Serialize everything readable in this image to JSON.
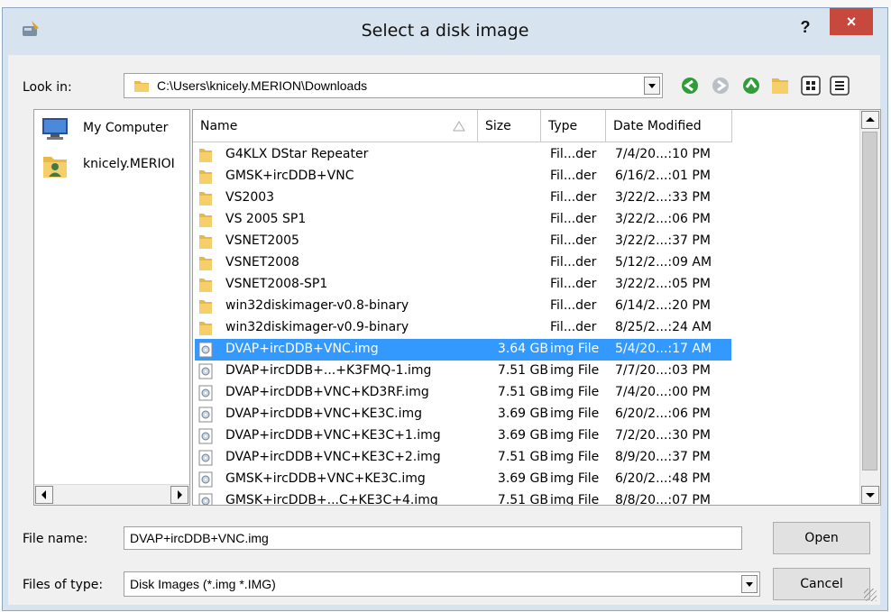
{
  "dialog": {
    "title": "Select a disk image",
    "help_label": "?",
    "close_label": "×"
  },
  "look_in": {
    "label": "Look in:",
    "path": "C:\\Users\\knicely.MERION\\Downloads",
    "toolbar_icons": [
      "back-icon",
      "forward-icon",
      "up-folder-icon",
      "new-folder-icon",
      "list-view-icon",
      "details-view-icon"
    ]
  },
  "places": [
    {
      "label": "My Computer",
      "icon": "computer-icon"
    },
    {
      "label": "knicely.MERIOI",
      "icon": "user-folder-icon"
    }
  ],
  "columns": {
    "name": "Name",
    "size": "Size",
    "type": "Type",
    "date": "Date Modified"
  },
  "files": [
    {
      "name": "G4KLX DStar Repeater",
      "size": "",
      "type": "Fil...der",
      "date": "7/4/20...:10 PM",
      "kind": "folder"
    },
    {
      "name": "GMSK+ircDDB+VNC",
      "size": "",
      "type": "Fil...der",
      "date": "6/16/2...:01 PM",
      "kind": "folder"
    },
    {
      "name": "VS2003",
      "size": "",
      "type": "Fil...der",
      "date": "3/22/2...:33 PM",
      "kind": "folder"
    },
    {
      "name": "VS 2005 SP1",
      "size": "",
      "type": "Fil...der",
      "date": "3/22/2...:06 PM",
      "kind": "folder"
    },
    {
      "name": "VSNET2005",
      "size": "",
      "type": "Fil...der",
      "date": "3/22/2...:37 PM",
      "kind": "folder"
    },
    {
      "name": "VSNET2008",
      "size": "",
      "type": "Fil...der",
      "date": "5/12/2...:09 AM",
      "kind": "folder"
    },
    {
      "name": "VSNET2008-SP1",
      "size": "",
      "type": "Fil...der",
      "date": "3/22/2...:05 PM",
      "kind": "folder"
    },
    {
      "name": "win32diskimager-v0.8-binary",
      "size": "",
      "type": "Fil...der",
      "date": "6/14/2...:20 PM",
      "kind": "folder"
    },
    {
      "name": "win32diskimager-v0.9-binary",
      "size": "",
      "type": "Fil...der",
      "date": "8/25/2...:24 AM",
      "kind": "folder"
    },
    {
      "name": "DVAP+ircDDB+VNC.img",
      "size": "3.64 GB",
      "type": "img File",
      "date": "5/4/20...:17 AM",
      "kind": "img"
    },
    {
      "name": "DVAP+ircDDB+...+K3FMQ-1.img",
      "size": "7.51 GB",
      "type": "img File",
      "date": "7/7/20...:03 PM",
      "kind": "img"
    },
    {
      "name": "DVAP+ircDDB+VNC+KD3RF.img",
      "size": "7.51 GB",
      "type": "img File",
      "date": "7/4/20...:00 PM",
      "kind": "img"
    },
    {
      "name": "DVAP+ircDDB+VNC+KE3C.img",
      "size": "3.69 GB",
      "type": "img File",
      "date": "6/20/2...:06 PM",
      "kind": "img"
    },
    {
      "name": "DVAP+ircDDB+VNC+KE3C+1.img",
      "size": "3.69 GB",
      "type": "img File",
      "date": "7/2/20...:30 PM",
      "kind": "img"
    },
    {
      "name": "DVAP+ircDDB+VNC+KE3C+2.img",
      "size": "7.51 GB",
      "type": "img File",
      "date": "8/9/20...:37 PM",
      "kind": "img"
    },
    {
      "name": "GMSK+ircDDB+VNC+KE3C.img",
      "size": "3.69 GB",
      "type": "img File",
      "date": "6/20/2...:48 PM",
      "kind": "img"
    },
    {
      "name": "GMSK+ircDDB+...C+KE3C+4.img",
      "size": "7.51 GB",
      "type": "img File",
      "date": "8/8/20...:07 PM",
      "kind": "img"
    }
  ],
  "selected_file_index": 9,
  "file_name": {
    "label": "File name:",
    "value": "DVAP+ircDDB+VNC.img"
  },
  "file_type": {
    "label": "Files of type:",
    "value": "Disk Images (*.img *.IMG)"
  },
  "buttons": {
    "open": "Open",
    "cancel": "Cancel"
  },
  "colors": {
    "selection": "#3399ff",
    "close_button": "#c7483d",
    "frame": "#d7e3ef",
    "nav_green": "#2f9e3a"
  }
}
